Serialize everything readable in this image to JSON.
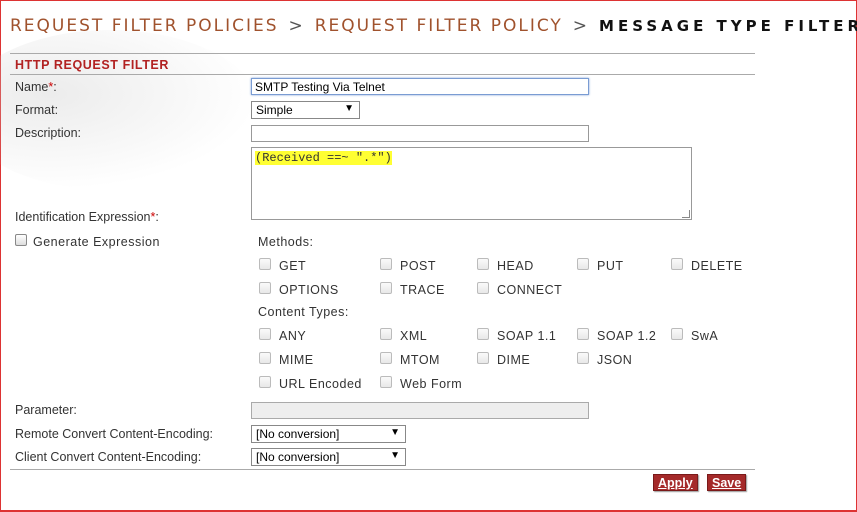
{
  "breadcrumb": {
    "item1": "REQUEST FILTER POLICIES",
    "item2": "REQUEST FILTER POLICY",
    "current": "MESSAGE TYPE FILTER",
    "separator": ">"
  },
  "section_title": "HTTP REQUEST FILTER",
  "form": {
    "name_label": "Name",
    "name_value": "SMTP Testing Via Telnet",
    "format_label": "Format:",
    "format_value": "Simple",
    "description_label": "Description:",
    "description_value": "",
    "identification_label": "Identification Expression",
    "expression_value": "(Received ==~ \".*\")",
    "generate_label": "Generate Expression",
    "required_marker": "*",
    "colon": ":"
  },
  "methods": {
    "heading": "Methods:",
    "options": [
      "GET",
      "POST",
      "HEAD",
      "PUT",
      "DELETE",
      "OPTIONS",
      "TRACE",
      "CONNECT"
    ]
  },
  "content_types": {
    "heading": "Content Types:",
    "options": [
      "ANY",
      "XML",
      "SOAP 1.1",
      "SOAP 1.2",
      "SwA",
      "MIME",
      "MTOM",
      "DIME",
      "JSON",
      "URL Encoded",
      "Web Form"
    ]
  },
  "parameter": {
    "label": "Parameter:",
    "value": ""
  },
  "remote_encoding": {
    "label": "Remote Convert Content-Encoding:",
    "value": "[No conversion]"
  },
  "client_encoding": {
    "label": "Client Convert Content-Encoding:",
    "value": "[No conversion]"
  },
  "buttons": {
    "apply": "Apply",
    "save": "Save"
  },
  "colors": {
    "accent": "#a52a2a",
    "title": "#b22222",
    "highlight": "#ffff33"
  }
}
